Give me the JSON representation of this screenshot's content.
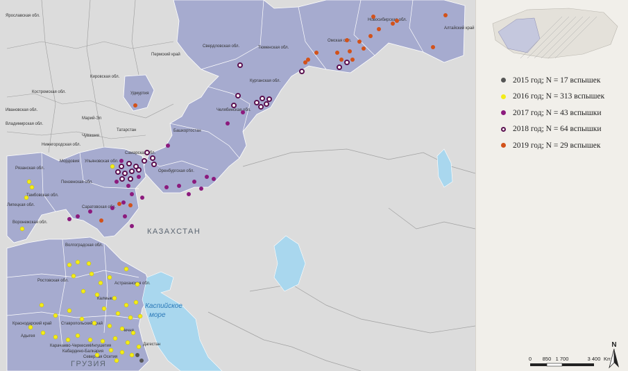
{
  "legend": [
    {
      "label": "2015 год; N = 17 вспышек",
      "color": "#555555",
      "style": "filled"
    },
    {
      "label": "2016 год; N = 313 вспышек",
      "color": "#f3ec1a",
      "style": "filled"
    },
    {
      "label": "2017 год; N = 43 вспышки",
      "color": "#8c1a7d",
      "style": "filled"
    },
    {
      "label": "2018 год; N = 64 вспышки",
      "color": "#5a0f4f",
      "style": "ring"
    },
    {
      "label": "2019 год; N = 29 вспышек",
      "color": "#d2521a",
      "style": "filled"
    }
  ],
  "map": {
    "country_labels": [
      "КАЗАХСТАН",
      "ГРУЗИЯ"
    ],
    "sea_label": [
      "Каспийское",
      "море"
    ],
    "region_labels": [
      "Пермский край",
      "Свердловская обл.",
      "Тюменская обл.",
      "Омская обл.",
      "Новосибирская обл.",
      "Алтайский край",
      "Курганская обл.",
      "Челябинская обл.",
      "Удмуртия",
      "Кировская обл.",
      "Костромская обл.",
      "Марий-Эл",
      "Чувашия",
      "Татарстан",
      "Башкортостан",
      "Нижегородская обл.",
      "Мордовия",
      "Самарская обл.",
      "Ульяновская обл.",
      "Оренбургская обл.",
      "Пензенская обл.",
      "Рязанская обл.",
      "Тамбовская обл.",
      "Липецкая обл.",
      "Воронежская обл.",
      "Саратовская обл.",
      "Волгоградская обл.",
      "Ростовская обл.",
      "Астраханская обл.",
      "Калмыкия",
      "Краснодарский край",
      "Ставропольский край",
      "Адыгея",
      "Карачаево-Черкесия",
      "Кабардино-Балкария",
      "Северная Осетия",
      "Ингушетия",
      "Чечня",
      "Дагестан",
      "Ярославская обл.",
      "Ивановская обл.",
      "Владимирская обл."
    ],
    "north_label": "N",
    "scale": {
      "ticks": [
        "0",
        "850",
        "1 700",
        "3 400"
      ],
      "unit": "Km"
    },
    "accent_colors": {
      "russia_regions": "#a6abcf",
      "other_land": "#dcdcdc",
      "water": "#a9d7ee"
    }
  }
}
